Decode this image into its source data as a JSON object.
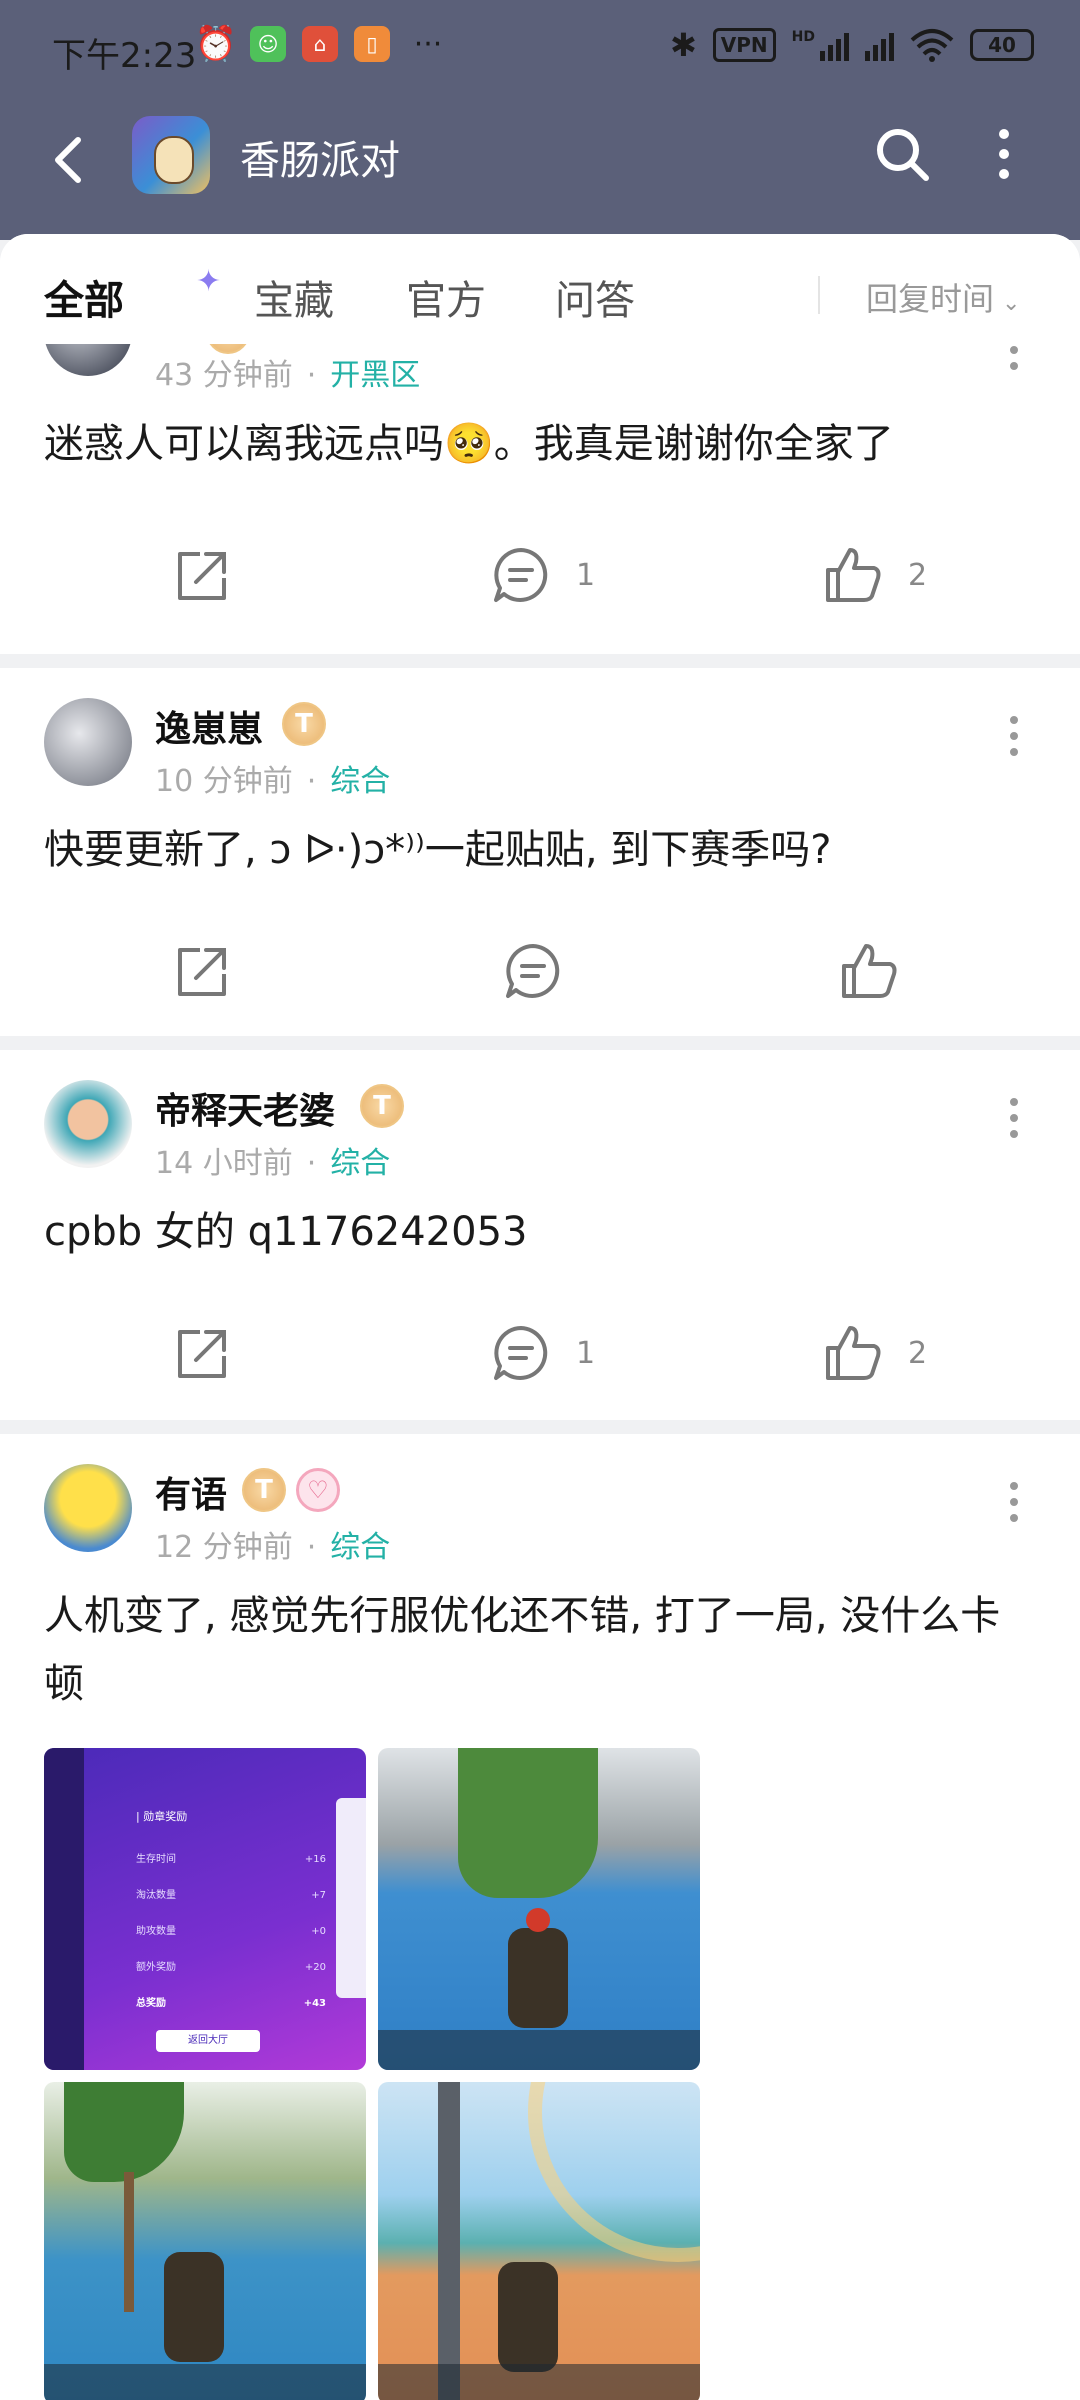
{
  "status_bar": {
    "time": "下午2:23",
    "network_label": "VPN",
    "signal_label": "HD",
    "battery": "40"
  },
  "header": {
    "title": "香肠派对"
  },
  "tabs": {
    "items": [
      "全部",
      "宝藏",
      "官方",
      "问答"
    ],
    "active_index": 0,
    "sort_label": "回复时间"
  },
  "posts": [
    {
      "username": "",
      "badge": "T",
      "time": "43 分钟前",
      "category": "开黑区",
      "content": "迷惑人可以离我远点吗🥺。我真是谢谢你全家了",
      "comment_count": "1",
      "like_count": "2"
    },
    {
      "username": "逸崽崽",
      "badge": "T",
      "time": "10 分钟前",
      "category": "综合",
      "content": "快要更新了, ↄ ᐅ·)ↄ*⁾⁾一起贴贴, 到下赛季吗?",
      "comment_count": "",
      "like_count": ""
    },
    {
      "username": "帝释天老婆",
      "badge": "T",
      "time": "14 小时前",
      "category": "综合",
      "content": "cpbb 女的 q1176242053",
      "comment_count": "1",
      "like_count": "2"
    },
    {
      "username": "有语",
      "badge": "T",
      "time": "12 分钟前",
      "category": "综合",
      "content": "人机变了, 感觉先行服优化还不错, 打了一局, 没什么卡顿",
      "comment_count": "",
      "like_count": ""
    }
  ],
  "reward_screen": {
    "title": "| 勋章奖励",
    "rows": [
      {
        "label": "生存时间",
        "value": "+16"
      },
      {
        "label": "淘汰数量",
        "value": "+7"
      },
      {
        "label": "助攻数量",
        "value": "+0"
      },
      {
        "label": "额外奖励",
        "value": "+20"
      }
    ],
    "total_label": "总奖励",
    "total_value": "+43",
    "button": "返回大厅"
  },
  "colors": {
    "header_bg": "#5b6079",
    "accent": "#23b1a6",
    "badge": "#e8b26a"
  }
}
